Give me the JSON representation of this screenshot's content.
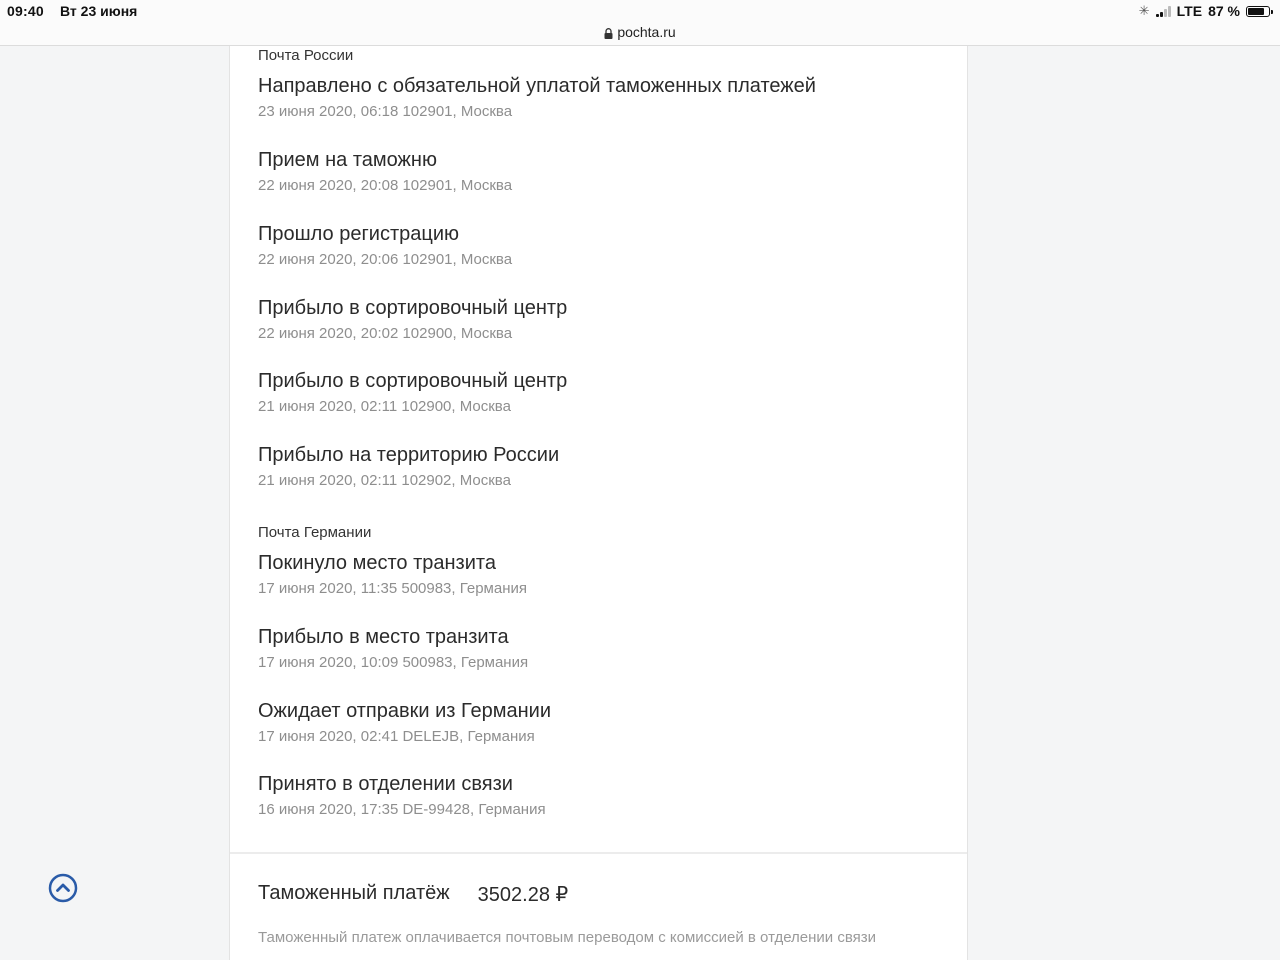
{
  "status_bar": {
    "time": "09:40",
    "date": "Вт 23 июня",
    "network": "LTE",
    "battery": "87 %",
    "battery_level": 0.87
  },
  "browser": {
    "url": "pochta.ru"
  },
  "tracking": {
    "groups": [
      {
        "label": "Почта России",
        "events": [
          {
            "title": "Направлено с обязательной уплатой таможенных платежей",
            "meta": "23 июня 2020, 06:18 102901, Москва"
          },
          {
            "title": "Прием на таможню",
            "meta": "22 июня 2020, 20:08 102901, Москва"
          },
          {
            "title": "Прошло регистрацию",
            "meta": "22 июня 2020, 20:06 102901, Москва"
          },
          {
            "title": "Прибыло в сортировочный центр",
            "meta": "22 июня 2020, 20:02 102900, Москва"
          },
          {
            "title": "Прибыло в сортировочный центр",
            "meta": "21 июня 2020, 02:11 102900, Москва"
          },
          {
            "title": "Прибыло на территорию России",
            "meta": "21 июня 2020, 02:11 102902, Москва"
          }
        ]
      },
      {
        "label": "Почта Германии",
        "events": [
          {
            "title": "Покинуло место транзита",
            "meta": "17 июня 2020, 11:35 500983, Германия"
          },
          {
            "title": "Прибыло в место транзита",
            "meta": "17 июня 2020, 10:09 500983, Германия"
          },
          {
            "title": "Ожидает отправки из Германии",
            "meta": "17 июня 2020, 02:41 DELEJB, Германия"
          },
          {
            "title": "Принято в отделении связи",
            "meta": "16 июня 2020, 17:35 DE-99428, Германия"
          }
        ]
      }
    ]
  },
  "payment": {
    "label": "Таможенный платёж",
    "value": "3502.28 ₽",
    "note": "Таможенный платеж оплачивается почтовым переводом с комиссией в отделении связи"
  },
  "colors": {
    "accent": "#2a5ba8"
  }
}
